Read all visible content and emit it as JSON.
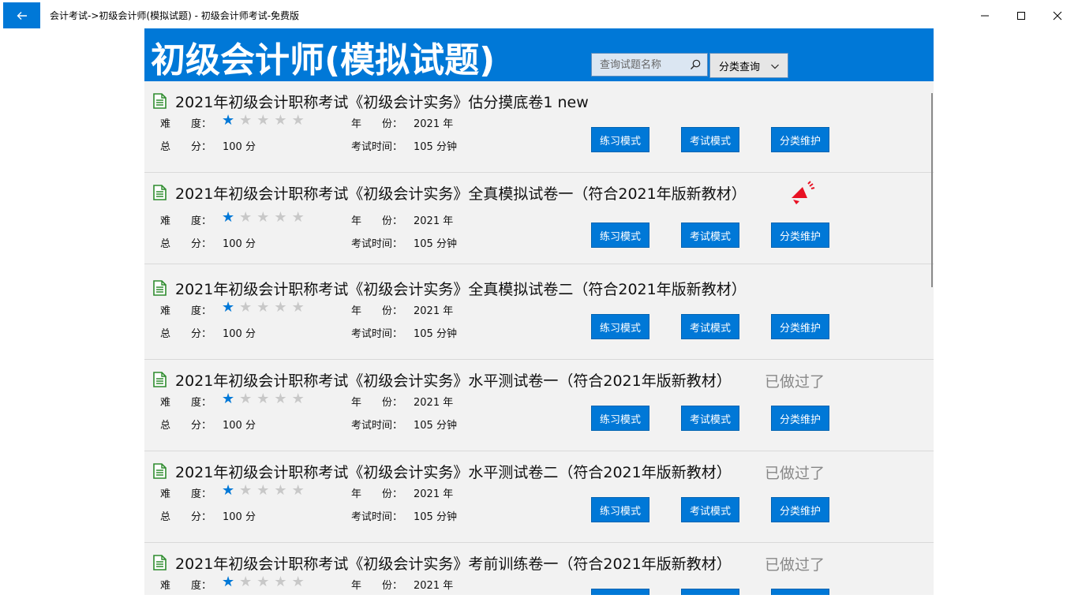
{
  "window": {
    "title": "会计考试->初级会计师(模拟试题) - 初级会计师考试-免费版",
    "back_icon": "back-arrow-icon"
  },
  "header": {
    "title": "初级会计师(模拟试题)",
    "search_placeholder": "查询试题名称",
    "category_label": "分类查询",
    "accent_color": "#0078d7"
  },
  "labels": {
    "difficulty": "难　　度：",
    "year": "年　　份：",
    "score": "总　　分：",
    "duration": "考试时间：",
    "practice": "练习模式",
    "exam": "考试模式",
    "maintain": "分类维护",
    "done": "已做过了"
  },
  "items": [
    {
      "title": "2021年初级会计职称考试《初级会计实务》估分摸底卷1 new",
      "difficulty": 1,
      "year": "2021 年",
      "score": "100 分",
      "duration": "105 分钟",
      "done": "",
      "hot": false
    },
    {
      "title": "2021年初级会计职称考试《初级会计实务》全真模拟试卷一（符合2021年版新教材）",
      "difficulty": 1,
      "year": "2021 年",
      "score": "100 分",
      "duration": "105 分钟",
      "done": "",
      "hot": true
    },
    {
      "title": "2021年初级会计职称考试《初级会计实务》全真模拟试卷二（符合2021年版新教材）",
      "difficulty": 1,
      "year": "2021 年",
      "score": "100 分",
      "duration": "105 分钟",
      "done": "",
      "hot": false
    },
    {
      "title": "2021年初级会计职称考试《初级会计实务》水平测试卷一（符合2021年版新教材）",
      "difficulty": 1,
      "year": "2021 年",
      "score": "100 分",
      "duration": "105 分钟",
      "done": "已做过了",
      "hot": false
    },
    {
      "title": "2021年初级会计职称考试《初级会计实务》水平测试卷二（符合2021年版新教材）",
      "difficulty": 1,
      "year": "2021 年",
      "score": "100 分",
      "duration": "105 分钟",
      "done": "已做过了",
      "hot": false
    },
    {
      "title": "2021年初级会计职称考试《初级会计实务》考前训练卷一（符合2021年版新教材）",
      "difficulty": 1,
      "year": "2021 年",
      "score": "",
      "duration": "",
      "done": "已做过了",
      "hot": false
    }
  ]
}
